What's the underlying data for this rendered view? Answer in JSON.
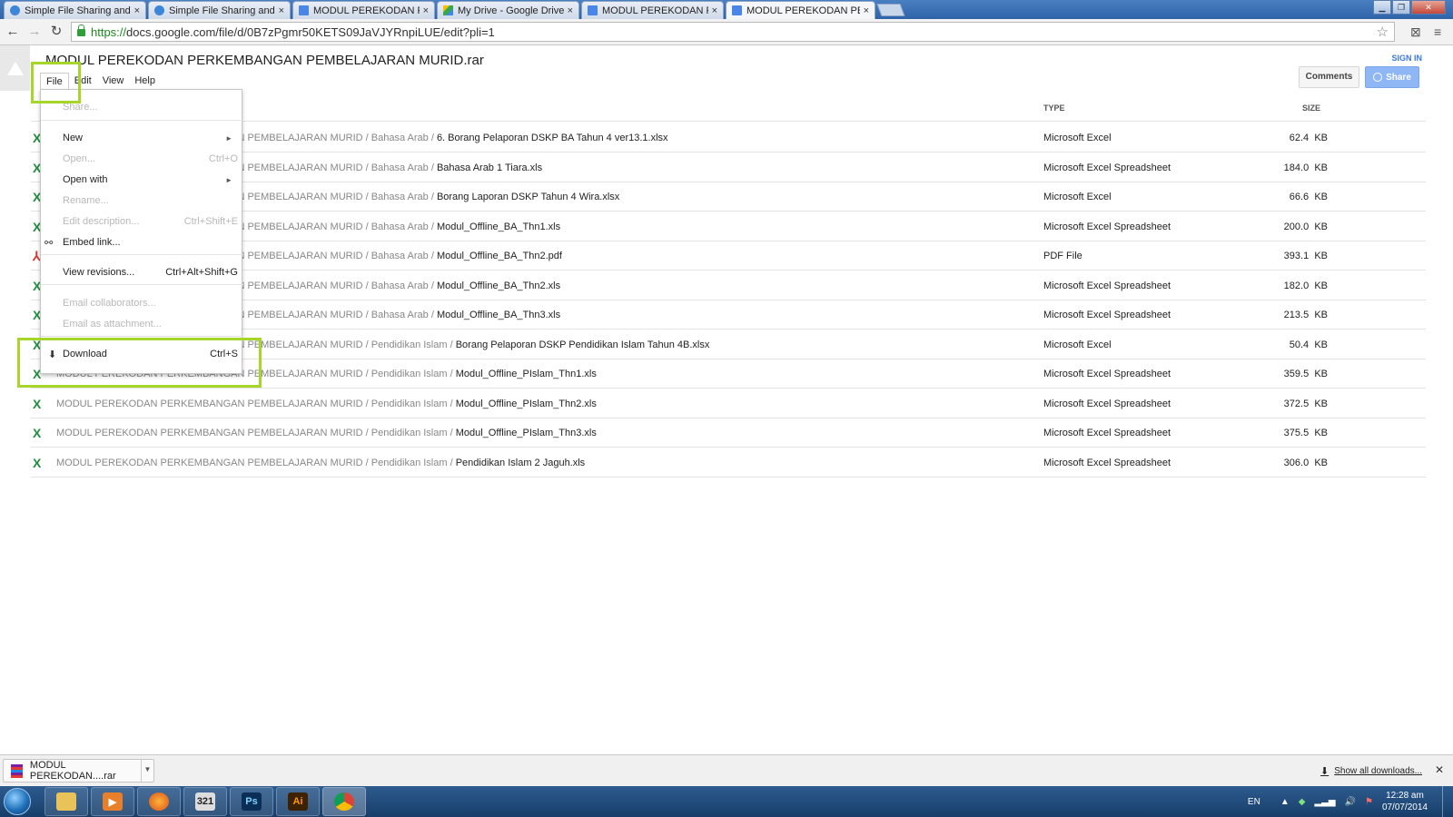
{
  "browser": {
    "tabs": [
      {
        "title": "Simple File Sharing and St",
        "icon": "share-icon",
        "active": false
      },
      {
        "title": "Simple File Sharing and St",
        "icon": "share-icon",
        "active": false
      },
      {
        "title": "MODUL PEREKODAN PER",
        "icon": "doc-icon",
        "active": false
      },
      {
        "title": "My Drive - Google Drive",
        "icon": "drive-icon",
        "active": false
      },
      {
        "title": "MODUL PEREKODAN PER",
        "icon": "doc-icon",
        "active": false
      },
      {
        "title": "MODUL PEREKODAN PER",
        "icon": "doc-icon",
        "active": true
      }
    ],
    "tab_close_glyph": "×",
    "url_scheme": "https://",
    "url_rest": "docs.google.com/file/d/0B7zPgmr50KETS09JaVJYRnpiLUE/edit?pli=1"
  },
  "viewer": {
    "title": "MODUL PEREKODAN PERKEMBANGAN PEMBELAJARAN MURID.rar",
    "menu": [
      "File",
      "Edit",
      "View",
      "Help"
    ],
    "sign_in": "SIGN IN",
    "comments_label": "Comments",
    "share_label": "Share",
    "col_type": "TYPE",
    "col_size": "SIZE"
  },
  "file_menu": {
    "items": [
      {
        "label": "Share...",
        "shortcut": "",
        "enabled": false,
        "submenu": false,
        "icon": ""
      },
      {
        "label": "New",
        "shortcut": "",
        "enabled": true,
        "submenu": true,
        "icon": ""
      },
      {
        "label": "Open...",
        "shortcut": "Ctrl+O",
        "enabled": false,
        "submenu": false,
        "icon": ""
      },
      {
        "label": "Open with",
        "shortcut": "",
        "enabled": true,
        "submenu": true,
        "icon": ""
      },
      {
        "label": "Rename...",
        "shortcut": "",
        "enabled": false,
        "submenu": false,
        "icon": ""
      },
      {
        "label": "Edit description...",
        "shortcut": "Ctrl+Shift+E",
        "enabled": false,
        "submenu": false,
        "icon": ""
      },
      {
        "label": "Embed link...",
        "shortcut": "",
        "enabled": true,
        "submenu": false,
        "icon": "link-icon"
      },
      {
        "label": "View revisions...",
        "shortcut": "Ctrl+Alt+Shift+G",
        "enabled": true,
        "submenu": false,
        "icon": ""
      },
      {
        "label": "Email collaborators...",
        "shortcut": "",
        "enabled": false,
        "submenu": false,
        "icon": ""
      },
      {
        "label": "Email as attachment...",
        "shortcut": "",
        "enabled": false,
        "submenu": false,
        "icon": ""
      },
      {
        "label": "Download",
        "shortcut": "Ctrl+S",
        "enabled": true,
        "submenu": false,
        "icon": "download-icon"
      }
    ]
  },
  "files": [
    {
      "icon": "excel-icon",
      "folder": "MODUL PEREKODAN PERKEMBANGAN PEMBELAJARAN MURID / Bahasa Arab / ",
      "name": "6. Borang Pelaporan DSKP BA Tahun 4 ver13.1.xlsx",
      "type": "Microsoft Excel",
      "size": "62.4",
      "unit": "KB"
    },
    {
      "icon": "excel-icon",
      "folder": "MODUL PEREKODAN PERKEMBANGAN PEMBELAJARAN MURID / Bahasa Arab / ",
      "name": "Bahasa Arab 1 Tiara.xls",
      "type": "Microsoft Excel Spreadsheet",
      "size": "184.0",
      "unit": "KB"
    },
    {
      "icon": "excel-icon",
      "folder": "MODUL PEREKODAN PERKEMBANGAN PEMBELAJARAN MURID / Bahasa Arab / ",
      "name": "Borang Laporan DSKP Tahun 4 Wira.xlsx",
      "type": "Microsoft Excel",
      "size": "66.6",
      "unit": "KB"
    },
    {
      "icon": "excel-icon",
      "folder": "MODUL PEREKODAN PERKEMBANGAN PEMBELAJARAN MURID / Bahasa Arab / ",
      "name": "Modul_Offline_BA_Thn1.xls",
      "type": "Microsoft Excel Spreadsheet",
      "size": "200.0",
      "unit": "KB"
    },
    {
      "icon": "pdf-icon",
      "folder": "MODUL PEREKODAN PERKEMBANGAN PEMBELAJARAN MURID / Bahasa Arab / ",
      "name": "Modul_Offline_BA_Thn2.pdf",
      "type": "PDF File",
      "size": "393.1",
      "unit": "KB"
    },
    {
      "icon": "excel-icon",
      "folder": "MODUL PEREKODAN PERKEMBANGAN PEMBELAJARAN MURID / Bahasa Arab / ",
      "name": "Modul_Offline_BA_Thn2.xls",
      "type": "Microsoft Excel Spreadsheet",
      "size": "182.0",
      "unit": "KB"
    },
    {
      "icon": "excel-icon",
      "folder": "MODUL PEREKODAN PERKEMBANGAN PEMBELAJARAN MURID / Bahasa Arab / ",
      "name": "Modul_Offline_BA_Thn3.xls",
      "type": "Microsoft Excel Spreadsheet",
      "size": "213.5",
      "unit": "KB"
    },
    {
      "icon": "excel-icon",
      "folder": "MODUL PEREKODAN PERKEMBANGAN PEMBELAJARAN MURID / Pendidikan Islam / ",
      "name": "Borang Pelaporan DSKP Pendidikan Islam Tahun 4B.xlsx",
      "type": "Microsoft Excel",
      "size": "50.4",
      "unit": "KB"
    },
    {
      "icon": "excel-icon",
      "folder": "MODUL PEREKODAN PERKEMBANGAN PEMBELAJARAN MURID / Pendidikan Islam / ",
      "name": "Modul_Offline_PIslam_Thn1.xls",
      "type": "Microsoft Excel Spreadsheet",
      "size": "359.5",
      "unit": "KB"
    },
    {
      "icon": "excel-icon",
      "folder": "MODUL PEREKODAN PERKEMBANGAN PEMBELAJARAN MURID / Pendidikan Islam / ",
      "name": "Modul_Offline_PIslam_Thn2.xls",
      "type": "Microsoft Excel Spreadsheet",
      "size": "372.5",
      "unit": "KB"
    },
    {
      "icon": "excel-icon",
      "folder": "MODUL PEREKODAN PERKEMBANGAN PEMBELAJARAN MURID / Pendidikan Islam / ",
      "name": "Modul_Offline_PIslam_Thn3.xls",
      "type": "Microsoft Excel Spreadsheet",
      "size": "375.5",
      "unit": "KB"
    },
    {
      "icon": "excel-icon",
      "folder": "MODUL PEREKODAN PERKEMBANGAN PEMBELAJARAN MURID / Pendidikan Islam / ",
      "name": "Pendidikan Islam 2 Jaguh.xls",
      "type": "Microsoft Excel Spreadsheet",
      "size": "306.0",
      "unit": "KB"
    }
  ],
  "downloads": {
    "item_name": "MODUL PEREKODAN....rar",
    "show_all": "Show all downloads..."
  },
  "taskbar": {
    "apps": [
      {
        "name": "explorer",
        "icon": "folder-icon"
      },
      {
        "name": "media-player",
        "icon": "play-icon"
      },
      {
        "name": "firefox",
        "icon": "firefox-icon"
      },
      {
        "name": "video-editor",
        "icon": "clapper-icon",
        "label": "321"
      },
      {
        "name": "photoshop",
        "icon": "photoshop-icon",
        "label": "Ps"
      },
      {
        "name": "illustrator",
        "icon": "illustrator-icon",
        "label": "Ai"
      },
      {
        "name": "chrome",
        "icon": "chrome-icon"
      }
    ],
    "lang": "EN",
    "time": "12:28 am",
    "date": "07/07/2014"
  },
  "colors": {
    "highlight": "#a6d62a",
    "excel": "#1e8e3e",
    "pdf": "#d9342b",
    "link": "#3b78e7"
  }
}
